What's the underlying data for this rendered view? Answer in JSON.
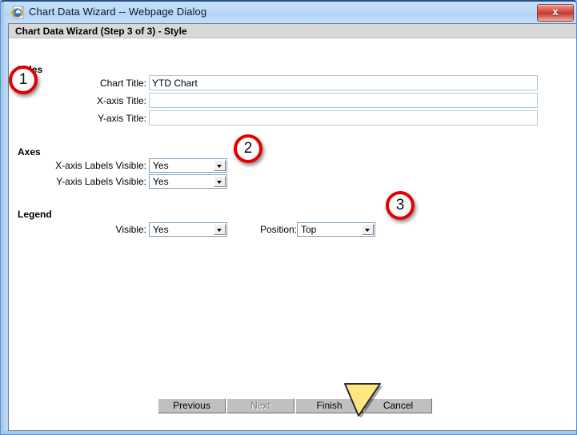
{
  "window": {
    "title": "Chart Data Wizard -- Webpage Dialog",
    "icon": "internet-explorer-icon",
    "close_label": "x"
  },
  "step_header": {
    "text": "Chart Data Wizard (Step 3 of 3) - Style"
  },
  "sections": {
    "titles": {
      "heading": "Titles",
      "fields": [
        {
          "label": "Chart Title:",
          "value": "YTD Chart",
          "placeholder": ""
        },
        {
          "label": "X-axis Title:",
          "value": "",
          "placeholder": ""
        },
        {
          "label": "Y-axis Title:",
          "value": "",
          "placeholder": ""
        }
      ]
    },
    "axes": {
      "heading": "Axes",
      "fields": [
        {
          "label": "X-axis Labels Visible:",
          "value": "Yes"
        },
        {
          "label": "Y-axis Labels Visible:",
          "value": "Yes"
        }
      ]
    },
    "legend": {
      "heading": "Legend",
      "visible_label": "Visible:",
      "visible_value": "Yes",
      "position_label": "Position:",
      "position_value": "Top"
    }
  },
  "buttons": {
    "previous": "Previous",
    "next": "Next",
    "finish": "Finish",
    "cancel": "Cancel"
  },
  "annotations": [
    {
      "number": "1"
    },
    {
      "number": "2"
    },
    {
      "number": "3"
    }
  ],
  "colors": {
    "title_bar": "#bcdaf8",
    "frame": "#a7c9ec",
    "close_button": "#c23b2e",
    "marker_ring": "#e00000",
    "cursor_fill": "#ffe680",
    "header_band": "#d8d8d8"
  }
}
